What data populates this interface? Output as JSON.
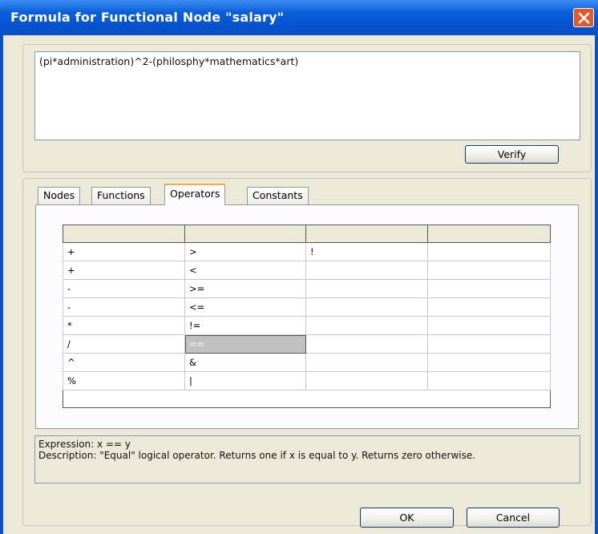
{
  "window": {
    "title": "Formula for Functional Node \"salary\""
  },
  "formula": {
    "value": "(pi*administration)^2-(philosphy*mathematics*art)"
  },
  "buttons": {
    "verify": "Verify",
    "ok": "OK",
    "cancel": "Cancel"
  },
  "tabs": [
    {
      "label": "Nodes"
    },
    {
      "label": "Functions"
    },
    {
      "label": "Operators",
      "active": true
    },
    {
      "label": "Constants"
    }
  ],
  "operators_table": {
    "headers": [
      "",
      "",
      "",
      ""
    ],
    "rows": [
      [
        "+",
        ">",
        "!",
        ""
      ],
      [
        "+",
        "<",
        "",
        ""
      ],
      [
        "-",
        ">=",
        "",
        ""
      ],
      [
        "-",
        "<=",
        "",
        ""
      ],
      [
        "*",
        "!=",
        "",
        ""
      ],
      [
        "/",
        "==",
        "",
        ""
      ],
      [
        "^",
        "&",
        "",
        ""
      ],
      [
        "%",
        "|",
        "",
        ""
      ]
    ],
    "selected_cell": "=="
  },
  "description": {
    "expression": "Expression:  x == y",
    "text": "Description:  \"Equal\" logical operator.  Returns one if x is equal to y.  Returns zero otherwise."
  },
  "colors": {
    "titlebar": "#0553d0",
    "close_button": "#e05a2b",
    "active_tab_accent": "#f0b23a",
    "dialog_background": "#ece9d8"
  },
  "icons": {
    "close": "close-icon"
  }
}
